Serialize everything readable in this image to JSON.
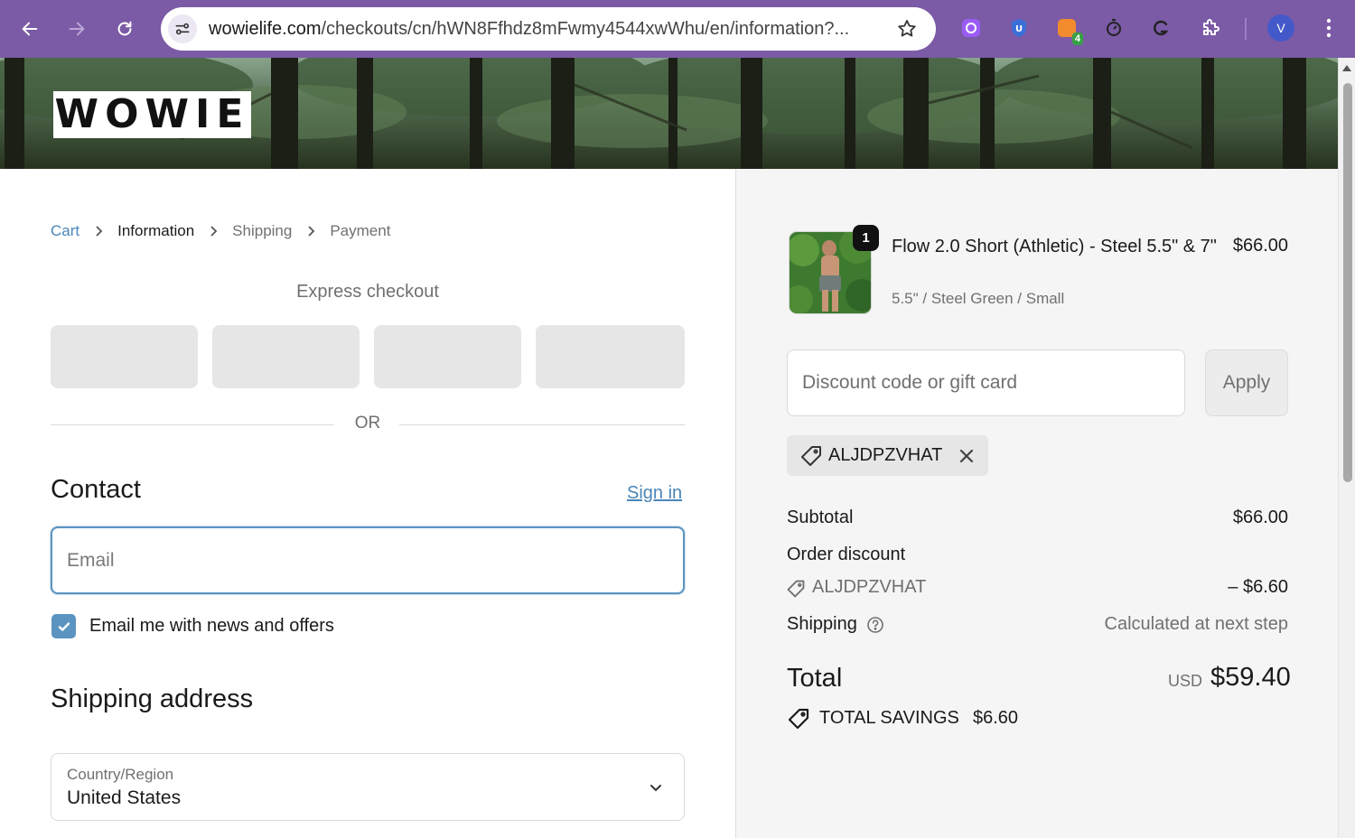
{
  "browser": {
    "url_host": "wowielife.com",
    "url_path": "/checkouts/cn/hWN8Ffhdz8mFwmy4544xwWhu/en/information?...",
    "avatar_initial": "V",
    "extension_badge": "4",
    "accent_color": "#7b5aa6"
  },
  "brand": {
    "logo_text": "WOWIE"
  },
  "breadcrumb": {
    "items": [
      "Cart",
      "Information",
      "Shipping",
      "Payment"
    ]
  },
  "express": {
    "title": "Express checkout",
    "divider": "OR"
  },
  "contact": {
    "title": "Contact",
    "sign_in": "Sign in",
    "email_placeholder": "Email",
    "email_value": "",
    "news_checkbox_label": "Email me with news and offers",
    "news_checked": true
  },
  "shipping_address": {
    "title": "Shipping address",
    "country_label": "Country/Region",
    "country_value": "United States"
  },
  "summary": {
    "product": {
      "name": "Flow 2.0 Short (Athletic) - Steel 5.5\" & 7\"",
      "variant": "5.5\" / Steel Green / Small",
      "price": "$66.00",
      "quantity": "1"
    },
    "discount_placeholder": "Discount code or gift card",
    "apply_label": "Apply",
    "applied_code": "ALJDPZVHAT",
    "subtotal_label": "Subtotal",
    "subtotal_value": "$66.00",
    "order_discount_label": "Order discount",
    "order_discount_code": "ALJDPZVHAT",
    "order_discount_value": "– $6.60",
    "shipping_label": "Shipping",
    "shipping_value": "Calculated at next step",
    "total_label": "Total",
    "total_currency": "USD",
    "total_value": "$59.40",
    "savings_label": "TOTAL SAVINGS",
    "savings_value": "$6.60"
  }
}
